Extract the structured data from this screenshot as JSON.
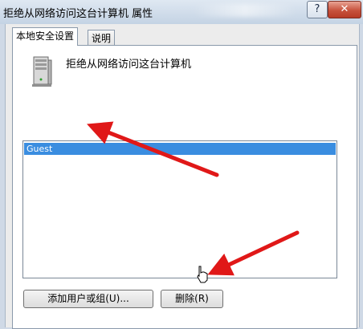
{
  "window": {
    "title": "拒绝从网络访问这台计算机 属性",
    "help_label": "?",
    "close_label": "✕"
  },
  "tabs": [
    {
      "label": "本地安全设置",
      "active": true
    },
    {
      "label": "说明",
      "active": false
    }
  ],
  "policy": {
    "name": "拒绝从网络访问这台计算机",
    "icon": "server-icon"
  },
  "list": {
    "items": [
      {
        "label": "Guest",
        "selected": true
      }
    ]
  },
  "buttons": {
    "add_label": "添加用户或组(U)...",
    "remove_label": "删除(R)"
  },
  "colors": {
    "selection": "#3a8de0",
    "annotation_arrow": "#e01818"
  }
}
